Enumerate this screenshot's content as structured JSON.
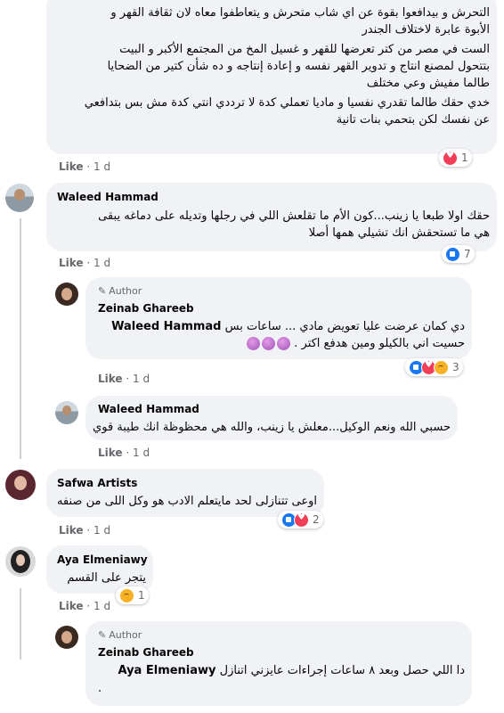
{
  "top_comment": {
    "lines": [
      "التحرش و بيدافعوا بقوة عن اي شاب متحرش و يتعاطفوا معاه لان ثقافة القهر و",
      "الأبوة عابرة لاختلاف الجندر",
      "الست في مصر من كتر تعرضها للقهر و غسيل المخ من المجتمع الأكبر و البيت",
      "بتتحول لمصنع انتاج و تدوير القهر نفسه و إعادة إنتاجه و ده شأن كتير من الضحايا",
      "طالما مفيش وعي مختلف",
      "خدي حقك طالما تقدري نفسيا و ماديا تعملي كدة لا ترددي انتي كدة مش بس بتدافعي",
      "عن نفسك لكن بتحمي بنات تانية"
    ],
    "like": "Like",
    "time": "1 d",
    "reaction_count": "1"
  },
  "waleed1": {
    "name": "Waleed Hammad",
    "lines": [
      "حقك اولا طبعا يا زينب...كون الأم ما تقلعش اللي في رجلها وتديله على دماغه يبقى",
      "هي ما تستحقش انك تشيلي همها أصلا"
    ],
    "like": "Like",
    "time": "1 d",
    "reaction_count": "7"
  },
  "zeinab1": {
    "author_badge": "Author",
    "name": "Zeinab Ghareeb",
    "mention": "Waleed Hammad",
    "line1_rest": "دي كمان عرضت عليا تعويض مادي ... ساعات بس",
    "line2": "حسيت اني بالكيلو ومين هدفع اكتر .",
    "like": "Like",
    "time": "1 d",
    "reaction_count": "3"
  },
  "waleed2": {
    "name": "Waleed Hammad",
    "text": "حسبي الله ونعم الوكيل...معلش يا زينب، والله هي محظوظة انك طيبة قوي",
    "like": "Like",
    "time": "1 d"
  },
  "safwa": {
    "name": "Safwa Artists",
    "text": "اوعى تتنازلى لحد مايتعلم الادب هو وكل اللى من صنفه",
    "like": "Like",
    "time": "1 d",
    "reaction_count": "2"
  },
  "aya": {
    "name": "Aya Elmeniawy",
    "text": "يتجر على القسم",
    "like": "Like",
    "time": "1 d",
    "reaction_count": "1"
  },
  "zeinab2": {
    "author_badge": "Author",
    "name": "Zeinab Ghareeb",
    "mention": "Aya Elmeniawy",
    "line1_rest": "دا اللي حصل وبعد ٨ ساعات إجراءات عايزني اتنازل",
    "line2": "."
  },
  "colors": {
    "bubble": "#f0f2f5",
    "like_blue": "#1877f2",
    "love_red": "#f33e58",
    "meta_gray": "#65676b"
  }
}
